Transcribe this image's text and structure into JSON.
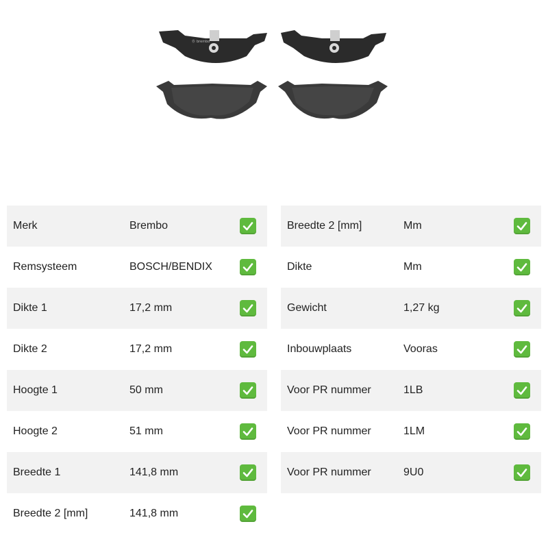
{
  "product_image": {
    "brand_mark": "brembo"
  },
  "colors": {
    "check_green": "#5fba3e",
    "row_shade": "#f2f2f2"
  },
  "specs_left": [
    {
      "label": "Merk",
      "value": "Brembo"
    },
    {
      "label": "Remsysteem",
      "value": "BOSCH/BENDIX"
    },
    {
      "label": "Dikte 1",
      "value": "17,2 mm"
    },
    {
      "label": "Dikte 2",
      "value": "17,2 mm"
    },
    {
      "label": "Hoogte 1",
      "value": "50 mm"
    },
    {
      "label": "Hoogte 2",
      "value": "51 mm"
    },
    {
      "label": "Breedte 1",
      "value": "141,8 mm"
    },
    {
      "label": "Breedte 2 [mm]",
      "value": "141,8 mm"
    }
  ],
  "specs_right": [
    {
      "label": "Breedte 2 [mm]",
      "value": "Mm"
    },
    {
      "label": "Dikte",
      "value": "Mm"
    },
    {
      "label": "Gewicht",
      "value": "1,27 kg"
    },
    {
      "label": "Inbouwplaats",
      "value": "Vooras"
    },
    {
      "label": "Voor PR nummer",
      "value": "1LB"
    },
    {
      "label": "Voor PR nummer",
      "value": "1LM"
    },
    {
      "label": "Voor PR nummer",
      "value": "9U0"
    }
  ]
}
